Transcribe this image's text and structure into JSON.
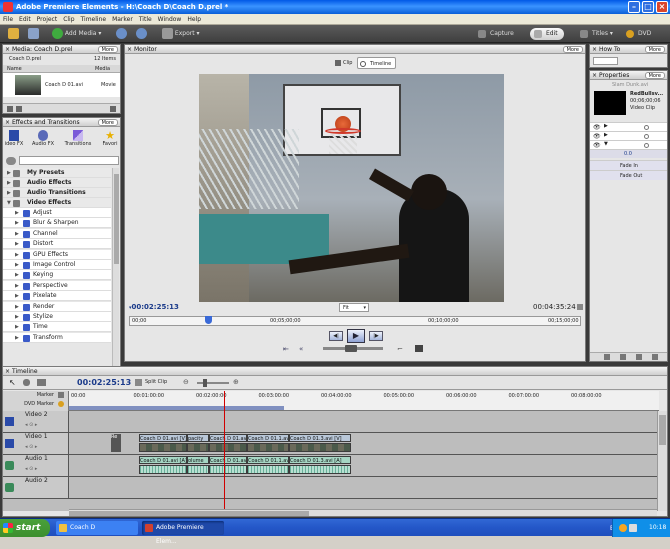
{
  "app": {
    "title": "Adobe Premiere Elements - H:\\Coach D\\Coach D.prel *"
  },
  "menu": [
    "File",
    "Edit",
    "Project",
    "Clip",
    "Timeline",
    "Marker",
    "Title",
    "Window",
    "Help"
  ],
  "toolbar": {
    "add_media": "Add Media",
    "export": "Export",
    "modes": [
      "Capture",
      "Edit",
      "Titles",
      "DVD"
    ]
  },
  "media": {
    "title": "Media: Coach D.prel",
    "more": "More",
    "project": "Coach D.prel",
    "count": "12 Items",
    "col_name": "Name",
    "col_media": "Media",
    "clip": "Coach D 01.avi",
    "clip_type": "Movie"
  },
  "effects": {
    "title": "Effects and Transitions",
    "more": "More",
    "tabs": [
      "Video FX",
      "Audio FX",
      "Transitions",
      "Favorites"
    ],
    "tab_short": "ideo FX",
    "tab_fav_short": "Favori",
    "categories": [
      "My Presets",
      "Audio Effects",
      "Audio Transitions",
      "Video Effects"
    ],
    "items": [
      "Adjust",
      "Blur & Sharpen",
      "Channel",
      "Distort",
      "GPU Effects",
      "Image Control",
      "Keying",
      "Perspective",
      "Pixelate",
      "Render",
      "Stylize",
      "Time",
      "Transform"
    ]
  },
  "monitor": {
    "title": "Monitor",
    "more": "More",
    "clip_tab": "Clip",
    "timeline_tab": "Timeline",
    "current": "00:02:25:13",
    "fit": "Fit",
    "duration": "00:04:35:24",
    "ruler": [
      "00;00",
      "00;05;00;00",
      "00;10;00;00",
      "00;15;00;00"
    ],
    "playhead_fraction": 0.173
  },
  "howto": {
    "title": "How To",
    "more": "More"
  },
  "properties": {
    "title": "Properties",
    "more": "More",
    "clip_file": "Slam Dunk.avi",
    "clip_name": "RedBullsv...",
    "clip_duration": "00;06;00;06",
    "clip_kind": "Video Clip",
    "value": "0.0",
    "fade_in": "Fade In",
    "fade_out": "Fade Out"
  },
  "timeline": {
    "title": "Timeline",
    "current": "00:02:25:13",
    "split_clip": "Split Clip",
    "marker": "Marker",
    "dvd_marker": "DVD Marker",
    "ruler": [
      "00:00",
      "00:01:00:00",
      "00:02:00:00",
      "00:03:00:00",
      "00:04:00:00",
      "00:05:00:00",
      "00:06:00:00",
      "00:07:00:00",
      "00:08:00:00"
    ],
    "playhead_fraction": 0.262,
    "tracks": [
      {
        "name": "Video 2",
        "kind": "video"
      },
      {
        "name": "Video 1",
        "kind": "video"
      },
      {
        "name": "Audio 1",
        "kind": "audio"
      },
      {
        "name": "Audio 2",
        "kind": "audio"
      }
    ],
    "video1_clips": [
      "Coach D 01.avi [V]",
      "pacity",
      "Coach D 01.avi [V]",
      "Coach D 01.1.avi [V]",
      "Coach D 01.3.avi [V]"
    ],
    "audio1_clips": [
      "Coach D 01.avi [A]",
      "olume",
      "Coach D 01.avi [A]",
      "Coach D 01.1.avi [A]",
      "Coach D 01.3.avi [A]"
    ],
    "clip_re": "Re"
  },
  "taskbar": {
    "start": "start",
    "tasks": [
      "Coach D",
      "Adobe Premiere Elem..."
    ],
    "lang": "EN",
    "time": "10:18"
  },
  "colors": {
    "accent": "#2a5ec8",
    "timecode": "#1a3a8a",
    "playhead": "#d00000"
  }
}
